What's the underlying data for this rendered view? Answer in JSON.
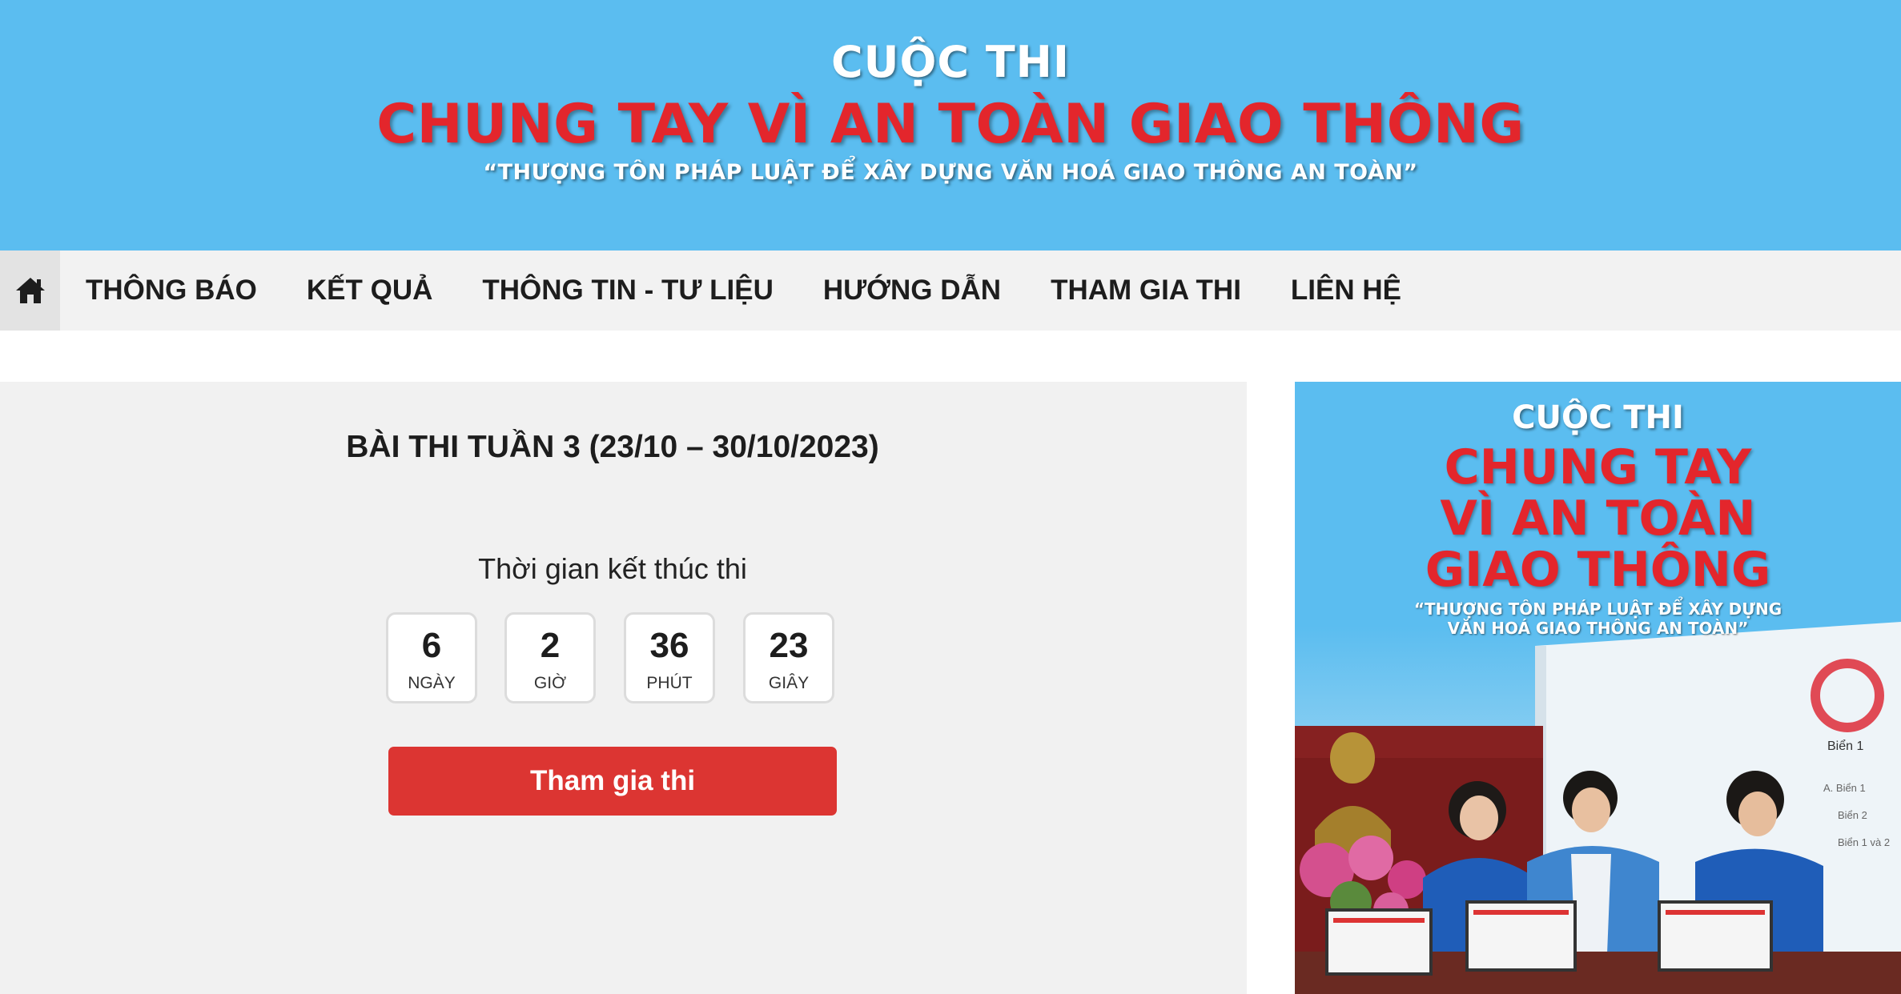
{
  "header": {
    "kicker": "CUỘC THI",
    "title": "CHUNG TAY VÌ AN TOÀN GIAO THÔNG",
    "slogan": "“THƯỢNG TÔN PHÁP LUẬT ĐỂ XÂY DỰNG VĂN HOÁ GIAO THÔNG AN TOÀN”"
  },
  "nav": {
    "home_icon": "home-icon",
    "items": [
      {
        "label": "THÔNG BÁO"
      },
      {
        "label": "KẾT QUẢ"
      },
      {
        "label": "THÔNG TIN - TƯ LIỆU"
      },
      {
        "label": "HƯỚNG DẪN"
      },
      {
        "label": "THAM GIA THI"
      },
      {
        "label": "LIÊN HỆ"
      }
    ]
  },
  "exam": {
    "title": "BÀI THI TUẦN 3 (23/10 – 30/10/2023)",
    "countdown_label": "Thời gian kết thúc thi",
    "countdown": [
      {
        "value": "6",
        "unit": "NGÀY"
      },
      {
        "value": "2",
        "unit": "GIỜ"
      },
      {
        "value": "36",
        "unit": "PHÚT"
      },
      {
        "value": "23",
        "unit": "GIÂY"
      }
    ],
    "join_button": "Tham gia thi"
  },
  "poster": {
    "kicker": "CUỘC THI",
    "title_lines": [
      "CHUNG TAY",
      "VÌ AN TOÀN",
      "GIAO THÔNG"
    ],
    "slogan_lines": [
      "“THƯỢNG TÔN PHÁP LUẬT ĐỂ XÂY DỰNG",
      "VĂN HOÁ GIAO THÔNG AN TOÀN”"
    ],
    "screen_label": "Biển 1",
    "screen_options": [
      "A. Biển 1",
      "Biển 2",
      "Biển 1 và 2"
    ]
  },
  "colors": {
    "banner_blue": "#5bbdf0",
    "title_red": "#e3262c",
    "button_red": "#dc3532",
    "nav_bg": "#f2f2f2",
    "panel_bg": "#f1f1f1"
  }
}
